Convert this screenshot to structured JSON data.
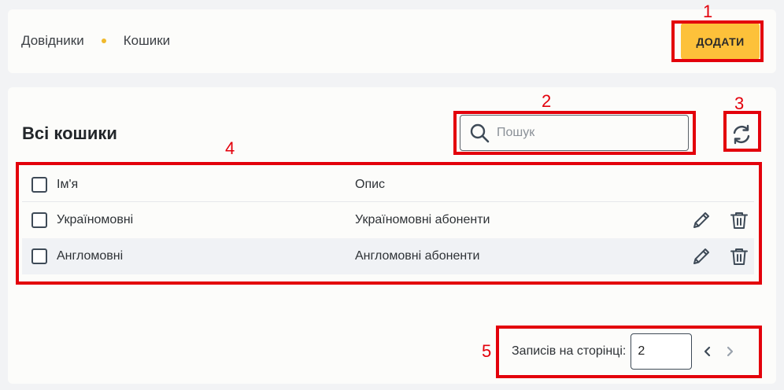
{
  "breadcrumb": {
    "items": [
      "Довідники",
      "Кошики"
    ]
  },
  "header": {
    "add_label": "ДОДАТИ"
  },
  "page": {
    "title": "Всі кошики"
  },
  "search": {
    "placeholder": "Пошук"
  },
  "table": {
    "columns": [
      "Ім'я",
      "Опис"
    ],
    "rows": [
      {
        "name": "Україномовні",
        "description": "Україномовні абоненти"
      },
      {
        "name": "Англомовні",
        "description": "Англомовні абоненти"
      }
    ]
  },
  "pagination": {
    "per_page_label": "Записів на сторінці:",
    "per_page_value": "2"
  },
  "annotations": [
    "1",
    "2",
    "3",
    "4",
    "5"
  ],
  "colors": {
    "accent": "#fdc13a",
    "annotation": "#e3000b",
    "icon": "#3e4a57"
  },
  "icons": [
    "search-icon",
    "refresh-icon",
    "pencil-icon",
    "trash-icon",
    "chevron-left-icon",
    "chevron-right-icon"
  ]
}
